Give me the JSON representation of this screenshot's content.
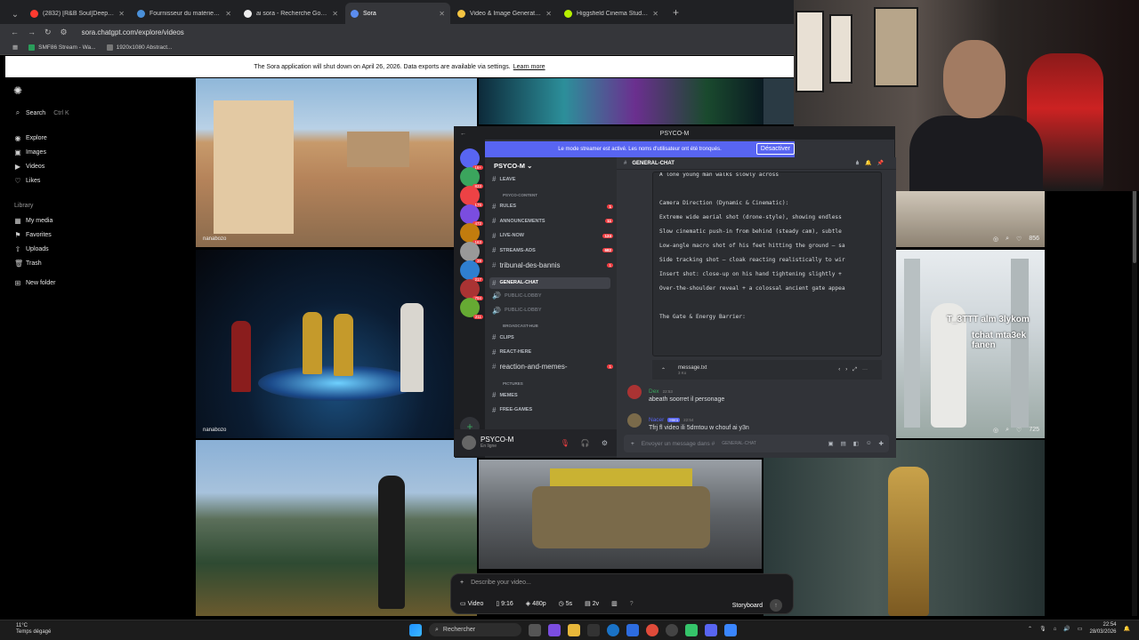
{
  "browser": {
    "tabs": [
      {
        "label": "(2832) [R&B Soul]Deep Cl",
        "color": "#ff3b30"
      },
      {
        "label": "Fournisseur du matériel Audio",
        "color": "#4a90d9"
      },
      {
        "label": "ai sora - Recherche Google",
        "color": "#eeeeee"
      },
      {
        "label": "Sora",
        "color": "#5b8def",
        "active": true
      },
      {
        "label": "Video & Image Generation - A",
        "color": "#f5c542"
      },
      {
        "label": "Higgsfield Cinema Studio | Pro",
        "color": "#b6f000"
      }
    ],
    "url": "sora.chatgpt.com/explore/videos",
    "bookmarks": [
      "SMF86 Stream - Wa...",
      "1920x1080 Abstract..."
    ]
  },
  "banner": {
    "text": "The Sora application will shut down on April 26, 2026. Data exports are available via settings.",
    "link": "Learn more"
  },
  "sidebar": {
    "search": "Search",
    "search_shortcut": "Ctrl K",
    "nav": [
      "Explore",
      "Images",
      "Videos",
      "Likes"
    ],
    "library_title": "Library",
    "library": [
      "My media",
      "Favorites",
      "Uploads",
      "Trash"
    ],
    "new_folder": "New folder"
  },
  "gallery": {
    "captions": [
      "nanabozo",
      "nanabozo"
    ],
    "counts": [
      "856",
      "725"
    ],
    "overlay_lines": [
      "T_3TTT alm 3lykom",
      "tchat mta3ek fanen"
    ]
  },
  "discord": {
    "window_title": "PSYCO-M",
    "streamer_banner": "Le mode streamer est activé. Les noms d'utilisateur ont été tronqués.",
    "streamer_button": "Désactiver",
    "guild": "PSYCO-M",
    "channels": [
      {
        "name": "LEAVE",
        "type": "small"
      },
      {
        "name": "PSYCO-CONTENT",
        "type": "category"
      },
      {
        "name": "RULES",
        "type": "small"
      },
      {
        "name": "ANNOUNCEMENTS",
        "type": "small"
      },
      {
        "name": "LIVE-NOW",
        "type": "small"
      },
      {
        "name": "STREAMS-ADS",
        "type": "small"
      },
      {
        "name": "tribunal-des-bannis",
        "type": "big"
      },
      {
        "name": "GENERAL-CHAT",
        "type": "selected"
      },
      {
        "name": "PUBLIC-LOBBY",
        "type": "voice"
      },
      {
        "name": "PUBLIC-LOBBY",
        "type": "voice"
      },
      {
        "name": "BROADCAST-HUB",
        "type": "category"
      },
      {
        "name": "CLIPS",
        "type": "small"
      },
      {
        "name": "REACT-HERE",
        "type": "small"
      },
      {
        "name": "reaction-and-memes-",
        "type": "big"
      },
      {
        "name": "PICTURES",
        "type": "category"
      },
      {
        "name": "MEMES",
        "type": "small"
      },
      {
        "name": "FREE-GAMES",
        "type": "small"
      }
    ],
    "server_badges": [
      "16+",
      "833",
      "176",
      "472",
      "163",
      "39",
      "217",
      "794",
      "211"
    ],
    "channel_badges": [
      "1",
      "11",
      "124",
      "682",
      "1",
      "1"
    ],
    "user": {
      "name": "PSYCO-M",
      "status": "En ligne"
    },
    "chat_header": "GENERAL-CHAT",
    "code_lines": [
      "A lone young man walks slowly across",
      "",
      "Camera Direction (Dynamic & Cinematic):",
      "Extreme wide aerial shot (drone-style), showing endless",
      "Slow cinematic push-in from behind (steady cam), subtle",
      "Low-angle macro shot of his feet hitting the ground — sa",
      "Side tracking shot — cloak reacting realistically to wir",
      "Insert shot: close-up on his hand tightening slightly +",
      "Over-the-shoulder reveal + a colossal ancient gate appea",
      "",
      "The Gate & Energy Barrier:"
    ],
    "file": {
      "name": "message.txt",
      "size": "3 Ko"
    },
    "messages": [
      {
        "author": "Dex",
        "time": "22:53",
        "text": "abeath soorret il personage"
      },
      {
        "author": "Nacer",
        "tag": "Hero",
        "time": "22:54",
        "text": "Tfrj fl video ili 5dmtou w chouf ai y3n"
      }
    ],
    "input_placeholder": "Envoyer un message dans #",
    "input_channel": "GENERAL-CHAT"
  },
  "prompt": {
    "placeholder": "Describe your video...",
    "options": [
      "Video",
      "9:16",
      "480p",
      "5s",
      "2v"
    ],
    "storyboard": "Storyboard"
  },
  "taskbar": {
    "weather_temp": "11°C",
    "weather_desc": "Temps dégagé",
    "search": "Rechercher",
    "time": "22:54",
    "date": "28/03/2026"
  }
}
